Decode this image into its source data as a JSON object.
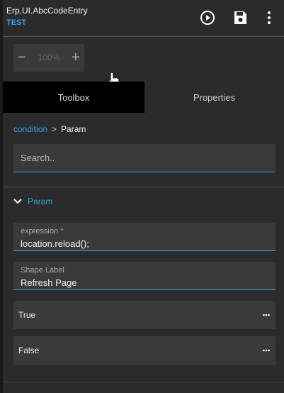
{
  "header": {
    "title": "Erp.UI.AbcCodeEntry",
    "subtitle": "TEST",
    "icons": [
      "play-circle-icon",
      "save-icon",
      "more-vertical-icon"
    ]
  },
  "zoom": {
    "minus": "−",
    "value": "100%",
    "plus": "+"
  },
  "tabs": [
    {
      "label": "Toolbox",
      "active": true
    },
    {
      "label": "Properties",
      "active": false
    }
  ],
  "breadcrumb": {
    "parent": "condition",
    "separator": ">",
    "current": "Param"
  },
  "search": {
    "placeholder": "Search..",
    "value": ""
  },
  "section": {
    "label": "Param",
    "expanded": true
  },
  "fields": [
    {
      "label": "expression *",
      "value": "location.reload();"
    },
    {
      "label": "Shape Label",
      "value": "Refresh Page"
    }
  ],
  "options": [
    {
      "label": "True"
    },
    {
      "label": "False"
    }
  ],
  "colors": {
    "accent": "#2fa4e7",
    "background": "#2b2b2b",
    "field": "#3a3a3a"
  }
}
